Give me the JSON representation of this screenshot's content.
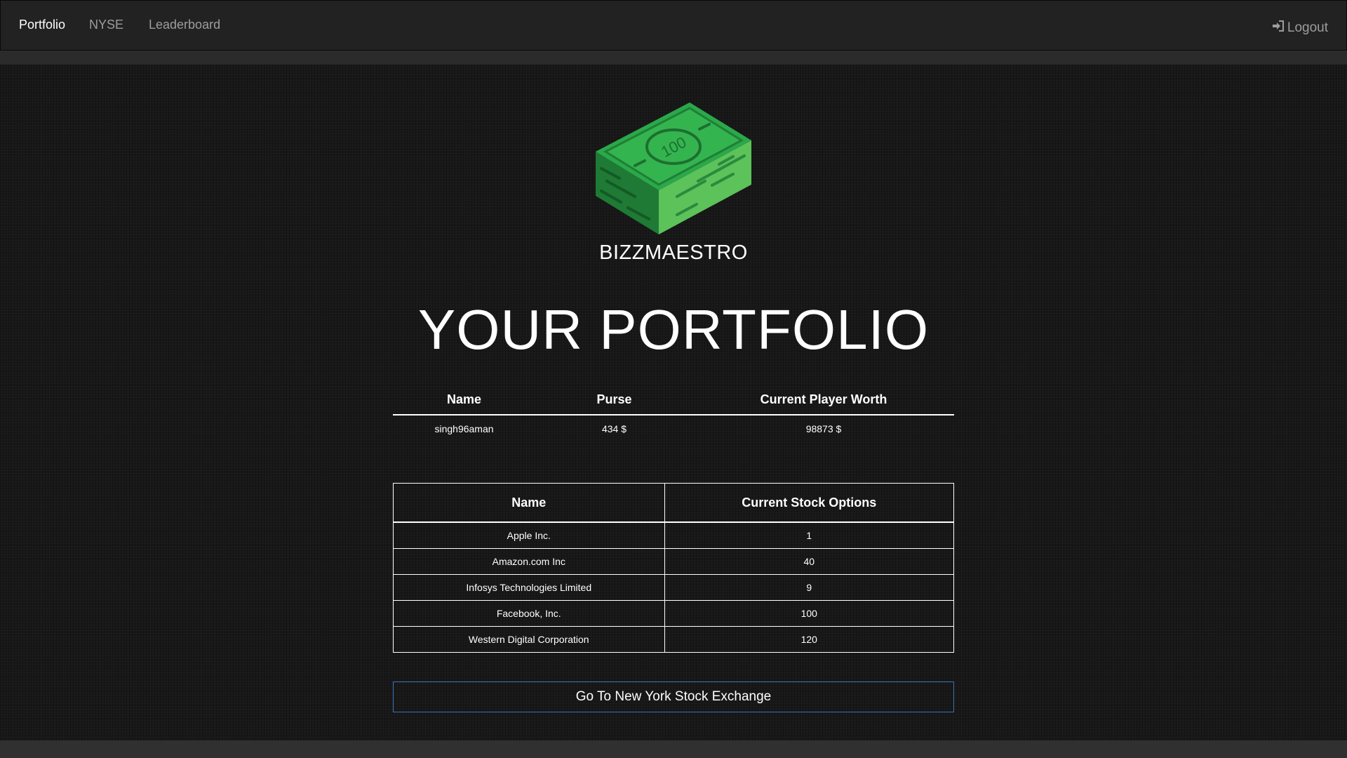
{
  "nav": {
    "items": [
      {
        "label": "Portfolio",
        "active": true
      },
      {
        "label": "NYSE",
        "active": false
      },
      {
        "label": "Leaderboard",
        "active": false
      }
    ],
    "logout_label": "Logout",
    "logout_icon": "sign-in-icon"
  },
  "brand": {
    "name": "BIZZMAESTRO",
    "logo_icon": "money-stack-icon",
    "logo_note": "100"
  },
  "page": {
    "title": "YOUR PORTFOLIO"
  },
  "summary": {
    "headers": [
      "Name",
      "Purse",
      "Current Player Worth"
    ],
    "row": [
      "singh96aman",
      "434 $",
      "98873 $"
    ]
  },
  "holdings": {
    "headers": [
      "Name",
      "Current Stock Options"
    ],
    "rows": [
      [
        "Apple Inc.",
        "1"
      ],
      [
        "Amazon.com Inc",
        "40"
      ],
      [
        "Infosys Technologies Limited",
        "9"
      ],
      [
        "Facebook, Inc.",
        "100"
      ],
      [
        "Western Digital Corporation",
        "120"
      ]
    ]
  },
  "actions": {
    "nyse_button_label": "Go To New York Stock Exchange"
  },
  "colors": {
    "navbar": "#222222",
    "background": "#181818",
    "nav_inactive": "#9d9d9d",
    "button_border": "#3a74b8",
    "money_green": "#2fa84a"
  }
}
